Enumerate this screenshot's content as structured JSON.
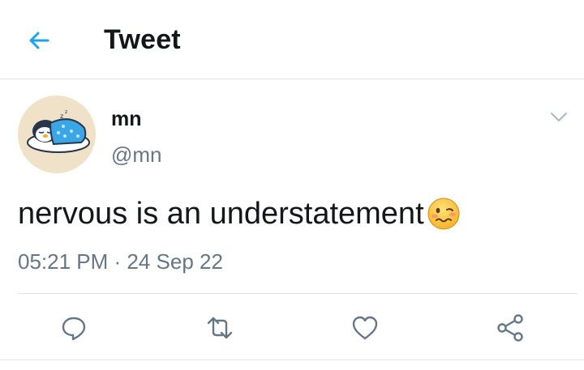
{
  "header": {
    "title": "Tweet",
    "back_icon": "arrow-left-icon",
    "accent_color": "#1da1f2"
  },
  "tweet": {
    "author": {
      "display_name": "mn",
      "handle": "@mn",
      "avatar_icon": "sleeping-penguin-avatar"
    },
    "text": "nervous is an understatement",
    "emoji": "woozy-face-emoji",
    "timestamp": "05:21 PM · 24 Sep 22"
  },
  "actions": [
    {
      "name": "reply",
      "icon": "reply-icon"
    },
    {
      "name": "retweet",
      "icon": "retweet-icon"
    },
    {
      "name": "like",
      "icon": "heart-icon"
    },
    {
      "name": "share",
      "icon": "share-icon"
    }
  ],
  "colors": {
    "text": "#14171a",
    "secondary_text": "#657786",
    "divider": "#dfe3e6",
    "avatar_bg": "#efe2c9"
  }
}
